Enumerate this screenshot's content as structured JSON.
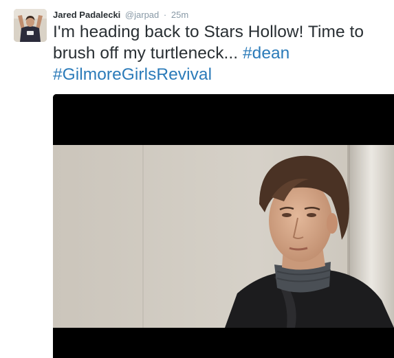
{
  "tweet": {
    "author_name": "Jared Padalecki",
    "author_handle": "@jarpad",
    "separator": "·",
    "timestamp": "25m",
    "text_part1": "I'm heading back to Stars Hollow! Time to brush off my turtleneck...",
    "hashtag1": "#dean",
    "hashtag2": "#GilmoreGirlsRevival"
  },
  "colors": {
    "name": "#292f33",
    "meta": "#8899a6",
    "hashtag": "#2b7bb9",
    "media_letterbox": "#000000"
  }
}
